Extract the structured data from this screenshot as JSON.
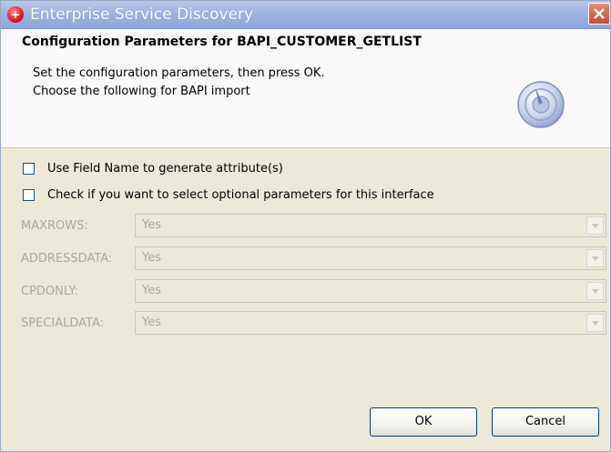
{
  "window": {
    "title": "Enterprise Service Discovery"
  },
  "banner": {
    "title": "Configuration Parameters for BAPI_CUSTOMER_GETLIST",
    "line1": "Set the configuration parameters, then press OK.",
    "line2": "Choose the following for BAPI import"
  },
  "options": [
    {
      "label": "Use Field Name to generate attribute(s)",
      "checked": false
    },
    {
      "label": "Check if you want to select optional parameters for this interface",
      "checked": false
    }
  ],
  "params": [
    {
      "label": "MAXROWS:",
      "value": "Yes"
    },
    {
      "label": "ADDRESSDATA:",
      "value": "Yes"
    },
    {
      "label": "CPDONLY:",
      "value": "Yes"
    },
    {
      "label": "SPECIALDATA:",
      "value": "Yes"
    }
  ],
  "buttons": {
    "ok": "OK",
    "cancel": "Cancel"
  },
  "colors": {
    "titlebar": "#9fb3e0",
    "disabled_text": "#aca899",
    "button_border": "#003c74"
  }
}
